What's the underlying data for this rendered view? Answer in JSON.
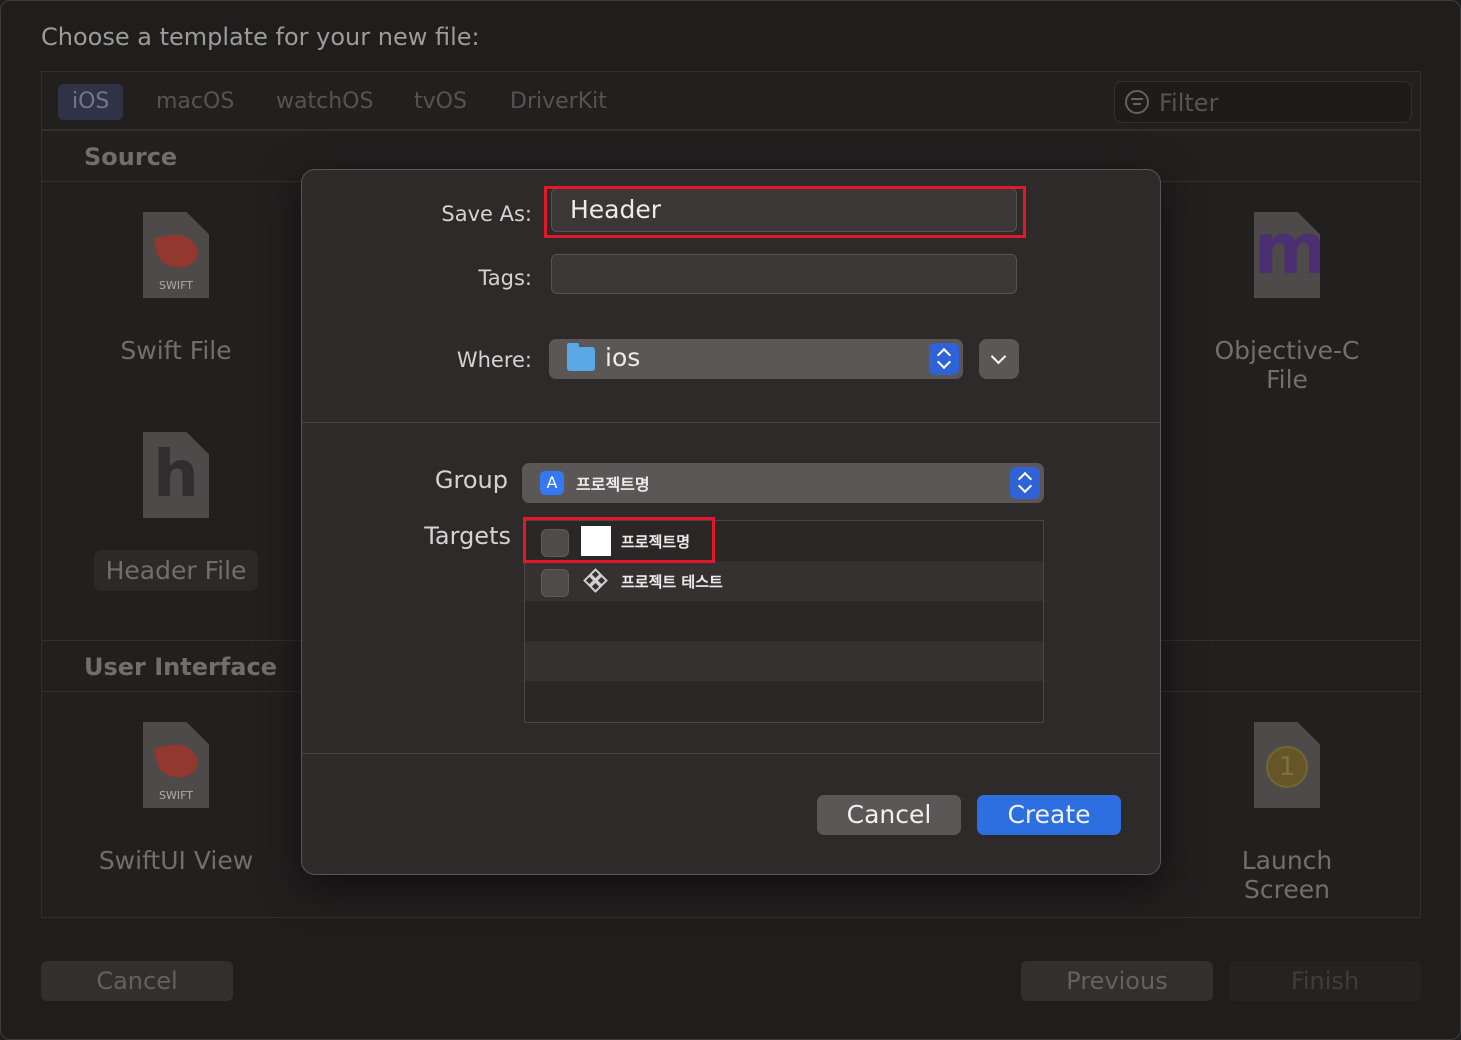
{
  "background": {
    "title": "Choose a template for your new file:",
    "platform_tabs": [
      "iOS",
      "macOS",
      "watchOS",
      "tvOS",
      "DriverKit"
    ],
    "filter_placeholder": "Filter",
    "sections": {
      "source": "Source",
      "user_interface": "User Interface"
    },
    "templates": {
      "swift_file": "Swift File",
      "header_file": "Header File",
      "objc_file": "Objective-C File",
      "swiftui_view": "SwiftUI View",
      "launch_screen": "Launch Screen",
      "swift_icon_text": "SWIFT",
      "objc_icon_letter": "m",
      "header_icon_letter": "h",
      "launch_icon_number": "1"
    },
    "buttons": {
      "cancel": "Cancel",
      "previous": "Previous",
      "finish": "Finish"
    }
  },
  "sheet": {
    "save_as_label": "Save As:",
    "save_as_value": "Header",
    "tags_label": "Tags:",
    "tags_value": "",
    "where_label": "Where:",
    "where_value": "ios",
    "group_label": "Group",
    "group_value": "프로젝트명",
    "targets_label": "Targets",
    "targets": [
      {
        "name": "프로젝트명",
        "checked": false
      },
      {
        "name": "프로젝트 테스트",
        "checked": false
      }
    ],
    "cancel_label": "Cancel",
    "create_label": "Create"
  },
  "colors": {
    "accent_blue": "#2d6ee0",
    "highlight_red": "#e0182a"
  }
}
